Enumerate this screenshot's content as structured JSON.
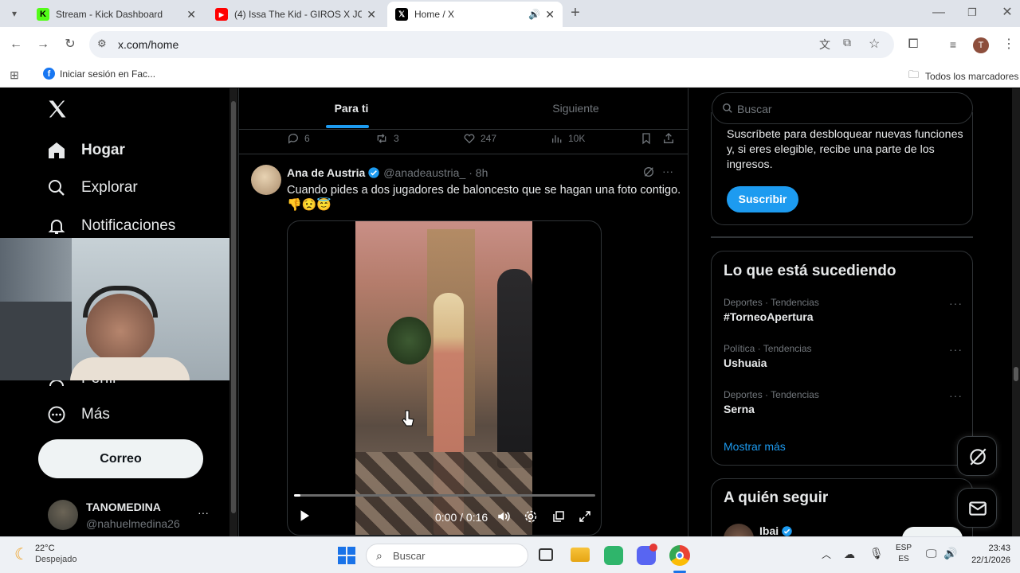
{
  "browser": {
    "tabs": [
      {
        "title": "Stream - Kick Dashboard",
        "favicon": "kick-icon",
        "color": "#53fc18"
      },
      {
        "title": "(4) Issa The Kid - GIROS X JCP (",
        "favicon": "youtube-icon",
        "color": "#ff0000"
      },
      {
        "title": "Home / X",
        "favicon": "x-icon",
        "color": "#000000",
        "active": true
      }
    ],
    "url": "x.com/home",
    "profile_initial": "T",
    "bookmarks": [
      {
        "label": "Iniciar sesión en Fac..."
      }
    ],
    "all_bookmarks_label": "Todos los marcadores"
  },
  "sidebar": {
    "nav": [
      {
        "label": "Hogar",
        "icon": "home-icon"
      },
      {
        "label": "Explorar",
        "icon": "search-icon"
      },
      {
        "label": "Notificaciones",
        "icon": "bell-icon"
      },
      {
        "label": "Perfil",
        "icon": "person-icon"
      },
      {
        "label": "Más",
        "icon": "more-circle-icon"
      }
    ],
    "post_button": "Correo",
    "account": {
      "name": "TANOMEDINA",
      "handle": "@nahuelmedina26"
    }
  },
  "feed": {
    "tabs": [
      {
        "label": "Para ti",
        "active": true
      },
      {
        "label": "Siguiente"
      }
    ],
    "prev_actions": {
      "replies": "6",
      "reposts": "3",
      "likes": "247",
      "views": "10K"
    },
    "tweet": {
      "author": "Ana de Austria",
      "handle": "@anadeaustria_",
      "time": "· 8h",
      "text": "Cuando pides a dos jugadores de baloncesto que se hagan una foto contigo.",
      "emojis": "👎😟😇",
      "video_time": "0:00 / 0:16",
      "video_progress": 0.02
    }
  },
  "right": {
    "search_placeholder": "Buscar",
    "premium": {
      "text": "Suscríbete para desbloquear nuevas funciones y, si eres elegible, recibe una parte de los ingresos.",
      "button": "Suscribir"
    },
    "trends_title": "Lo que está sucediendo",
    "trends": [
      {
        "category": "Deportes · Tendencias",
        "name": "#TorneoApertura"
      },
      {
        "category": "Política · Tendencias",
        "name": "Ushuaia"
      },
      {
        "category": "Deportes · Tendencias",
        "name": "Serna"
      }
    ],
    "show_more": "Mostrar más",
    "who_to_follow_title": "A quién seguir",
    "follow_suggestion": "Ibai"
  },
  "taskbar": {
    "weather_temp": "22°C",
    "weather_desc": "Despejado",
    "search_placeholder": "Buscar",
    "lang_top": "ESP",
    "lang_bottom": "ES",
    "time": "23:43",
    "date": "22/1/2026"
  },
  "colors": {
    "accent": "#1d9bf0",
    "bg": "#000000",
    "border": "#2f3336",
    "muted": "#71767b",
    "text": "#e7e9ea"
  }
}
